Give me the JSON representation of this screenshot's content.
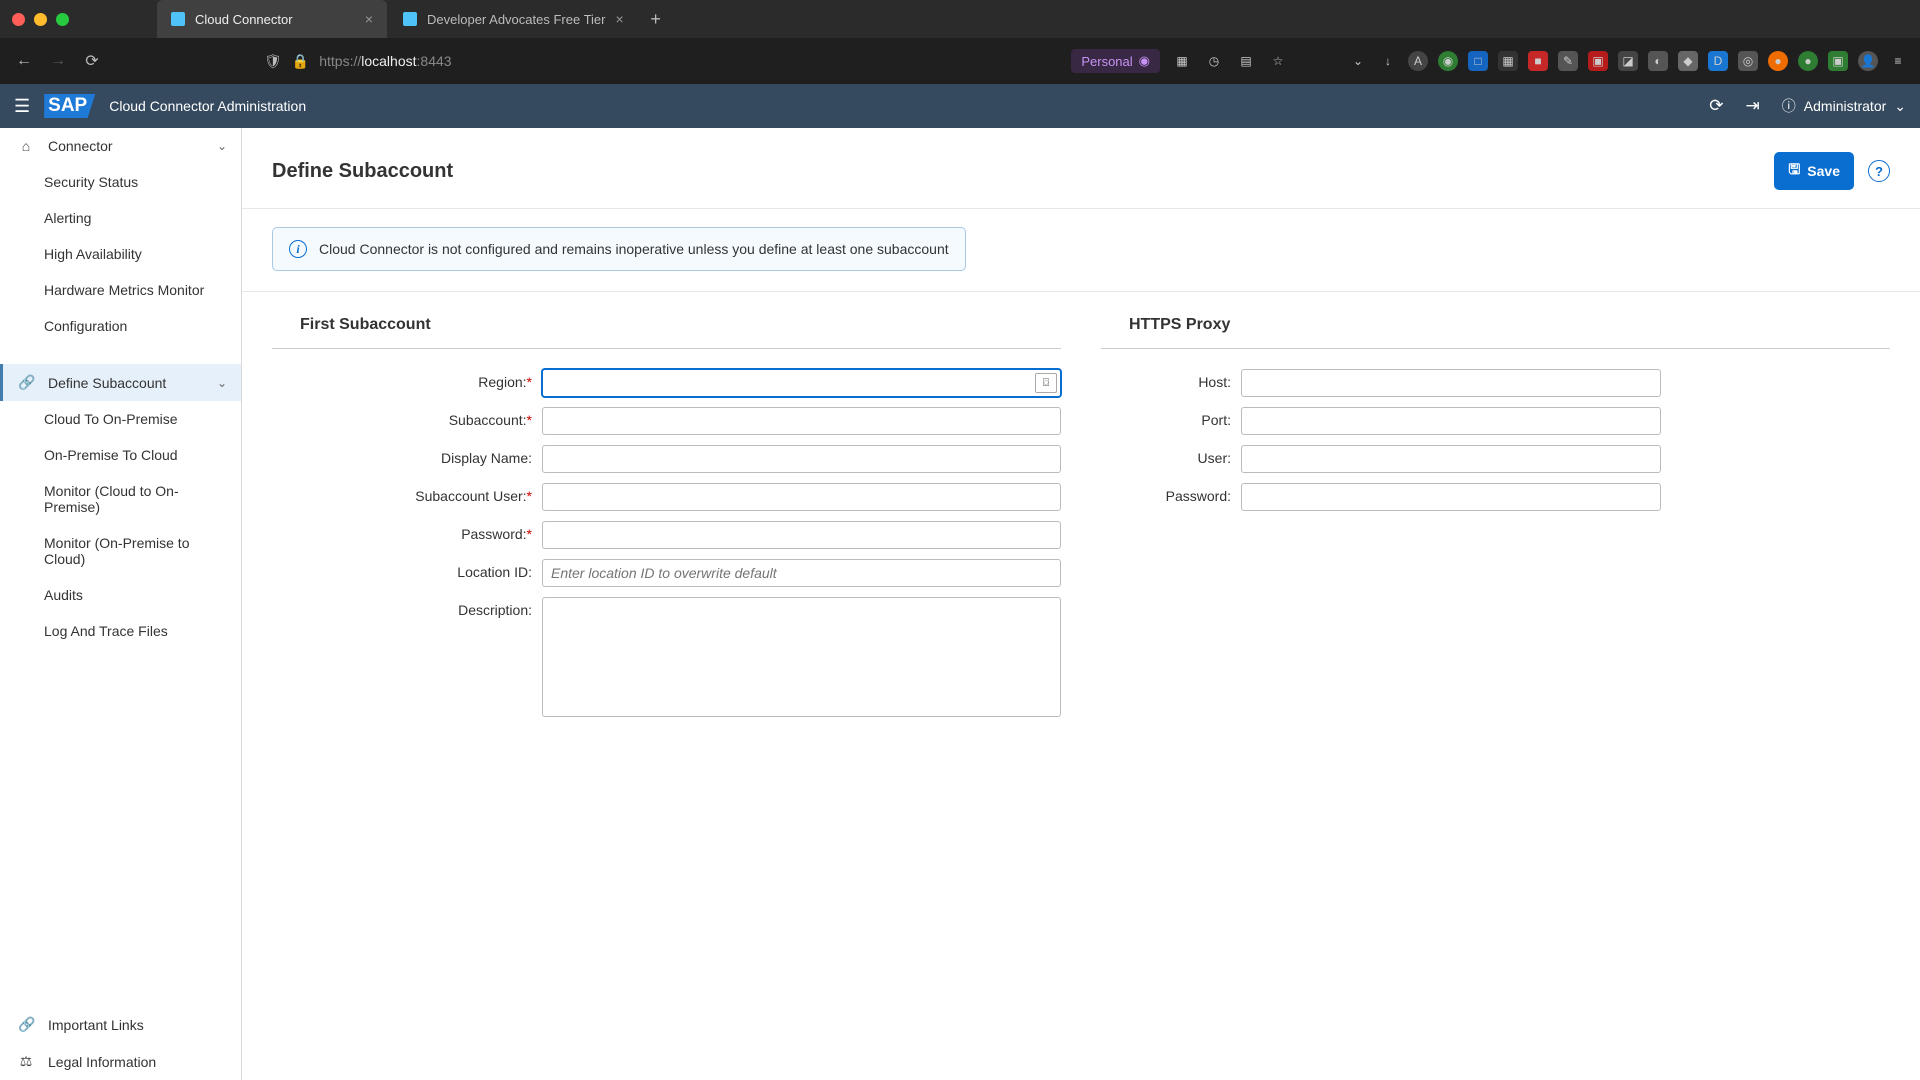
{
  "browser": {
    "tabs": [
      {
        "title": "Cloud Connector",
        "active": true,
        "favicon_color": "#4fc3f7"
      },
      {
        "title": "Developer Advocates Free Tier",
        "active": false,
        "favicon_color": "#4fc3f7"
      }
    ],
    "url_prefix": "https://",
    "url_host": "localhost",
    "url_port": ":8443",
    "personal_label": "Personal"
  },
  "header": {
    "logo_text": "SAP",
    "app_title": "Cloud Connector Administration",
    "user": "Administrator"
  },
  "sidebar": {
    "groups": [
      {
        "label": "Connector",
        "icon": "⌂",
        "expandable": true,
        "children": [
          {
            "label": "Security Status"
          },
          {
            "label": "Alerting"
          },
          {
            "label": "High Availability"
          },
          {
            "label": "Hardware Metrics Monitor"
          },
          {
            "label": "Configuration"
          }
        ]
      },
      {
        "label": "Define Subaccount",
        "icon": "🔗",
        "expandable": true,
        "selected": true,
        "children": [
          {
            "label": "Cloud To On-Premise"
          },
          {
            "label": "On-Premise To Cloud"
          },
          {
            "label": "Monitor (Cloud to On-Premise)"
          },
          {
            "label": "Monitor (On-Premise to Cloud)"
          },
          {
            "label": "Audits"
          },
          {
            "label": "Log And Trace Files"
          }
        ]
      }
    ],
    "footer": [
      {
        "label": "Important Links",
        "icon": "🔗"
      },
      {
        "label": "Legal Information",
        "icon": "⚖"
      }
    ]
  },
  "page": {
    "title": "Define Subaccount",
    "save_label": "Save",
    "info_message": "Cloud Connector is not configured and remains inoperative unless you define at least one subaccount",
    "section1_title": "First Subaccount",
    "section2_title": "HTTPS Proxy",
    "fields": {
      "region": {
        "label": "Region:",
        "required": true,
        "value": ""
      },
      "subaccount": {
        "label": "Subaccount:",
        "required": true,
        "value": ""
      },
      "display_name": {
        "label": "Display Name:",
        "required": false,
        "value": ""
      },
      "subaccount_user": {
        "label": "Subaccount User:",
        "required": true,
        "value": ""
      },
      "password": {
        "label": "Password:",
        "required": true,
        "value": ""
      },
      "location_id": {
        "label": "Location ID:",
        "required": false,
        "value": "",
        "placeholder": "Enter location ID to overwrite default"
      },
      "description": {
        "label": "Description:",
        "required": false,
        "value": ""
      }
    },
    "proxy_fields": {
      "host": {
        "label": "Host:",
        "value": ""
      },
      "port": {
        "label": "Port:",
        "value": ""
      },
      "user": {
        "label": "User:",
        "value": ""
      },
      "password": {
        "label": "Password:",
        "value": ""
      }
    }
  }
}
